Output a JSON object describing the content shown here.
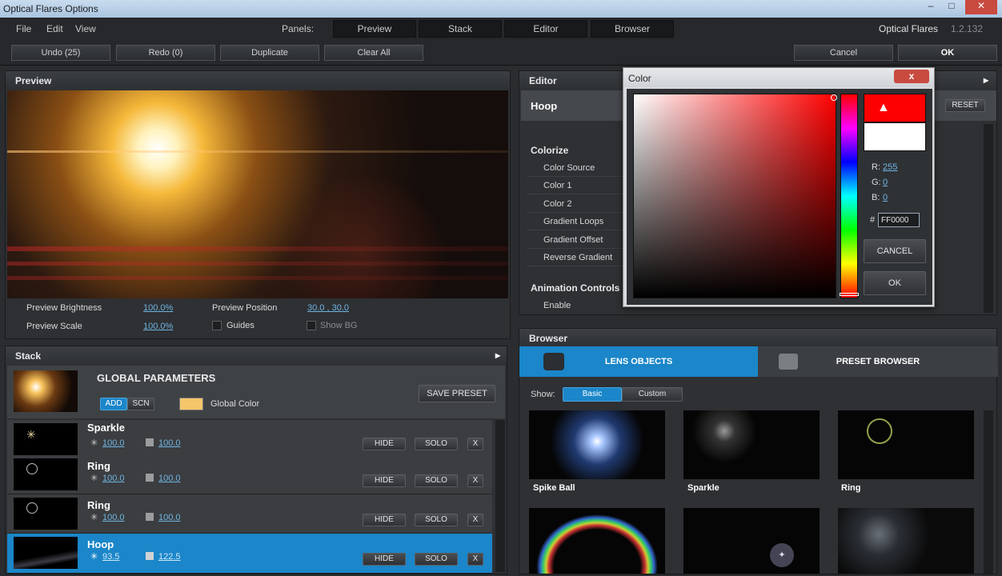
{
  "window": {
    "title": "Optical Flares Options"
  },
  "menu": {
    "file": "File",
    "edit": "Edit",
    "view": "View",
    "panels_label": "Panels:",
    "panels": [
      "Preview",
      "Stack",
      "Editor",
      "Browser"
    ],
    "product": "Optical Flares",
    "version": "1.2.132"
  },
  "toolbar": {
    "undo": "Undo (25)",
    "redo": "Redo (0)",
    "duplicate": "Duplicate",
    "clear_all": "Clear All",
    "cancel": "Cancel",
    "ok": "OK"
  },
  "preview": {
    "title": "Preview",
    "brightness_label": "Preview Brightness",
    "brightness_value": "100.0%",
    "scale_label": "Preview Scale",
    "scale_value": "100.0%",
    "position_label": "Preview Position",
    "position_value": "30.0 , 30.0",
    "guides_label": "Guides",
    "showbg_label": "Show BG"
  },
  "stack": {
    "title": "Stack",
    "global": {
      "title": "GLOBAL PARAMETERS",
      "add": "ADD",
      "scn": "SCN",
      "color_label": "Global Color",
      "save_preset": "SAVE PRESET",
      "color": "#f5c76a"
    },
    "items": [
      {
        "name": "Sparkle",
        "brightness": "100.0",
        "scale": "100.0"
      },
      {
        "name": "Ring",
        "brightness": "100.0",
        "scale": "100.0"
      },
      {
        "name": "Ring",
        "brightness": "100.0",
        "scale": "100.0"
      },
      {
        "name": "Hoop",
        "brightness": "93.5",
        "scale": "122.5"
      }
    ],
    "hide": "HIDE",
    "solo": "SOLO",
    "close": "X"
  },
  "editor": {
    "title": "Editor",
    "object": "Hoop",
    "reset": "RESET",
    "section_colorize": "Colorize",
    "rows": [
      "Color Source",
      "Color 1",
      "Color 2",
      "Gradient Loops",
      "Gradient Offset",
      "Reverse Gradient"
    ],
    "section_anim": "Animation Controls",
    "enable": "Enable"
  },
  "color_dialog": {
    "title": "Color",
    "close": "x",
    "r_label": "R:",
    "r": "255",
    "g_label": "G:",
    "g": "0",
    "b_label": "B:",
    "b": "0",
    "hash": "#",
    "hex": "FF0000",
    "cancel": "CANCEL",
    "ok": "OK",
    "selected": "#ff0000",
    "previous": "#ffffff"
  },
  "browser": {
    "title": "Browser",
    "tab_lens": "LENS OBJECTS",
    "tab_preset": "PRESET BROWSER",
    "show_label": "Show:",
    "basic": "Basic",
    "custom": "Custom",
    "items": [
      "Spike Ball",
      "Sparkle",
      "Ring"
    ]
  },
  "colors": {
    "accent": "#1b86c9",
    "link": "#6fb6e4"
  }
}
